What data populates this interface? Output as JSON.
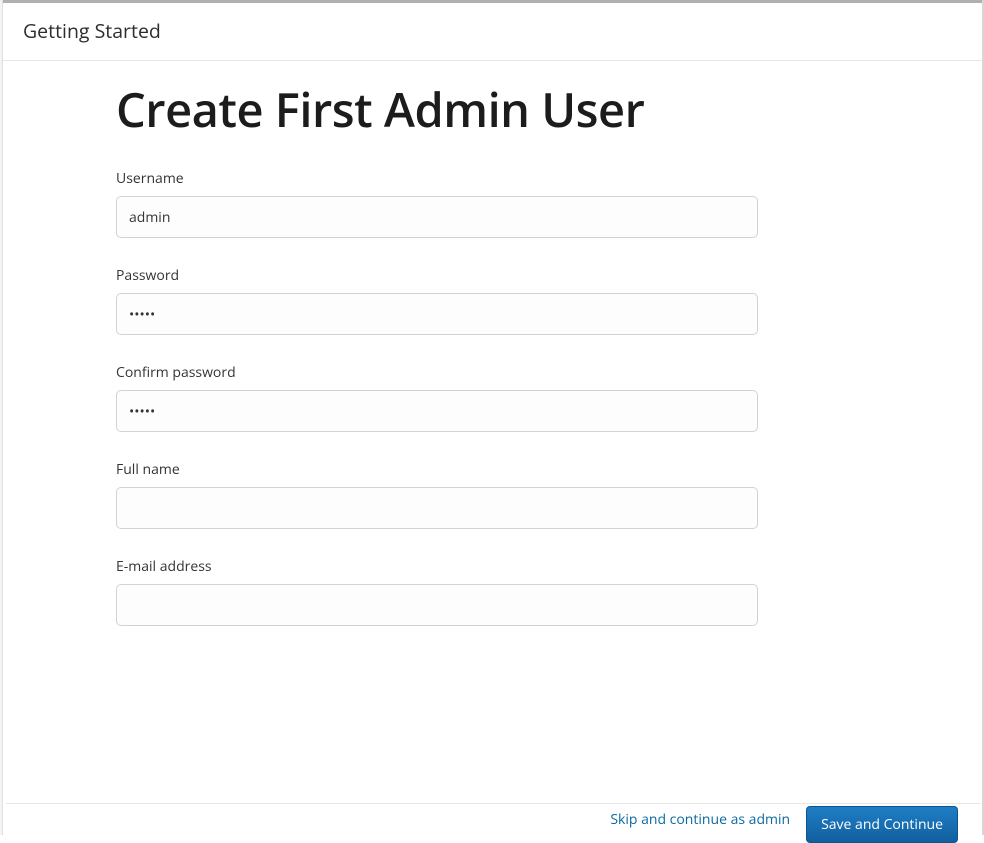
{
  "header": {
    "title": "Getting Started"
  },
  "page": {
    "title": "Create First Admin User"
  },
  "form": {
    "username": {
      "label": "Username",
      "value": "admin"
    },
    "password": {
      "label": "Password",
      "value": "•••••"
    },
    "confirm_password": {
      "label": "Confirm password",
      "value": "•••••"
    },
    "full_name": {
      "label": "Full name",
      "value": ""
    },
    "email": {
      "label": "E-mail address",
      "value": ""
    }
  },
  "footer": {
    "skip_label": "Skip and continue as admin",
    "primary_label": "Save and Continue"
  }
}
